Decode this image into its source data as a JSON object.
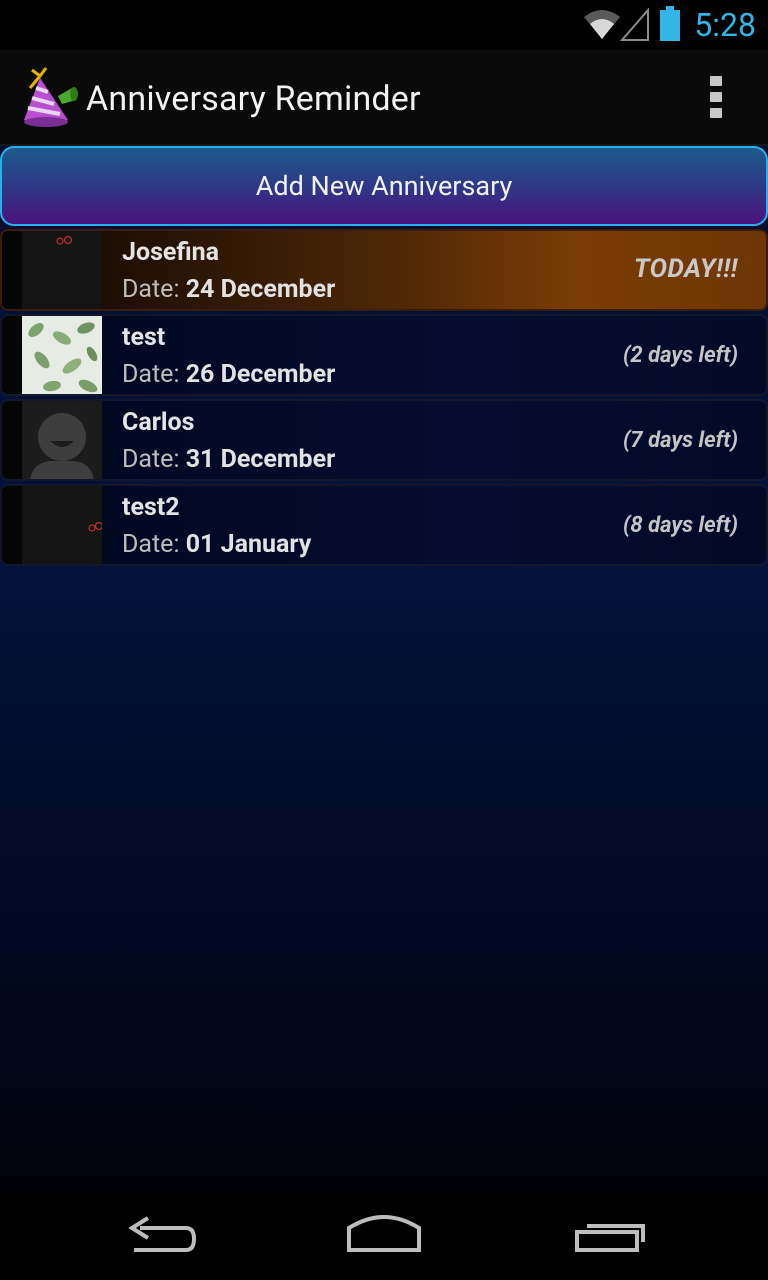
{
  "status_bar": {
    "time": "5:28",
    "icons": [
      "wifi-icon",
      "signal-icon",
      "battery-icon"
    ],
    "accent_color": "#33b5e5"
  },
  "action_bar": {
    "title": "Anniversary Reminder",
    "app_icon": "party-hat-icon",
    "menu_icon": "overflow-menu-icon"
  },
  "add_button": {
    "label": "Add New Anniversary"
  },
  "list": {
    "date_prefix": "Date:",
    "items": [
      {
        "name": "Josefina",
        "date": "24 December",
        "remaining": "TODAY!!!",
        "highlight": true,
        "thumbnail": "dark-photo"
      },
      {
        "name": "test",
        "date": "26 December",
        "remaining": "(2 days left)",
        "highlight": false,
        "thumbnail": "leaves-photo"
      },
      {
        "name": "Carlos",
        "date": "31 December",
        "remaining": "(7 days left)",
        "highlight": false,
        "thumbnail": "default-avatar"
      },
      {
        "name": "test2",
        "date": "01 January",
        "remaining": "(8 days left)",
        "highlight": false,
        "thumbnail": "dark-photo"
      }
    ]
  },
  "nav_bar": {
    "icons": [
      "back-icon",
      "home-icon",
      "recent-apps-icon"
    ]
  }
}
